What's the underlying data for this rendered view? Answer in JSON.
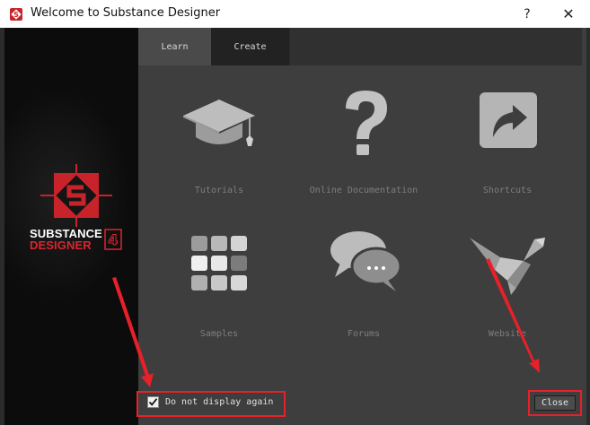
{
  "window": {
    "title": "Welcome to Substance Designer",
    "help_glyph": "?",
    "close_glyph": "✕"
  },
  "brand": {
    "line1": "SUBSTANCE",
    "line2": "DESIGNER",
    "badge": "4",
    "accent_color": "#d8262e"
  },
  "tabs": [
    {
      "label": "Learn",
      "active": true
    },
    {
      "label": "Create",
      "active": false
    }
  ],
  "tiles": [
    {
      "label": "Tutorials",
      "icon": "graduation-cap-icon"
    },
    {
      "label": "Online Documentation",
      "icon": "question-mark-icon"
    },
    {
      "label": "Shortcuts",
      "icon": "share-arrow-icon"
    },
    {
      "label": "Samples",
      "icon": "grid-icon"
    },
    {
      "label": "Forums",
      "icon": "chat-bubbles-icon"
    },
    {
      "label": "Website",
      "icon": "origami-bird-icon"
    }
  ],
  "footer": {
    "checkbox_label": "Do not display again",
    "checkbox_checked": true,
    "close_label": "Close"
  },
  "annotation_color": "#e8202a"
}
